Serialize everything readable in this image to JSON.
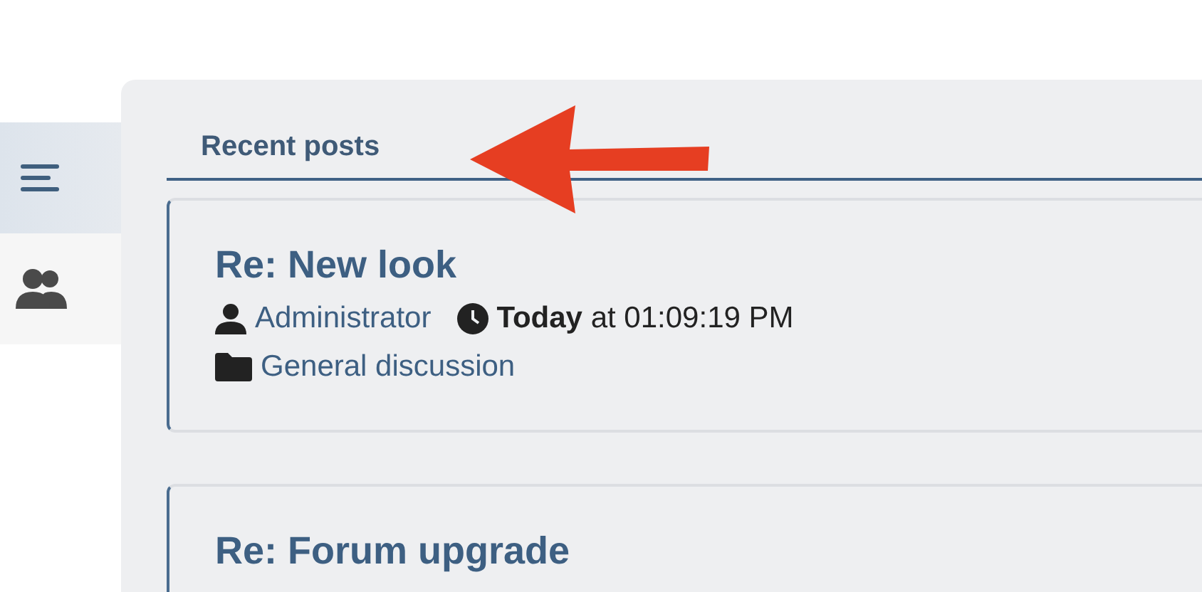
{
  "sidebar": {
    "items": [
      {
        "kind": "menu",
        "selected": true
      },
      {
        "kind": "users",
        "selected": false
      }
    ]
  },
  "heading": "Recent posts",
  "posts": [
    {
      "title": "Re: New look",
      "author": "Administrator",
      "time": "**Today** at 01:09:19 PM",
      "forum": "General discussion"
    },
    {
      "title": "Re: Forum upgrade"
    }
  ],
  "annotation": {
    "kind": "arrow"
  }
}
